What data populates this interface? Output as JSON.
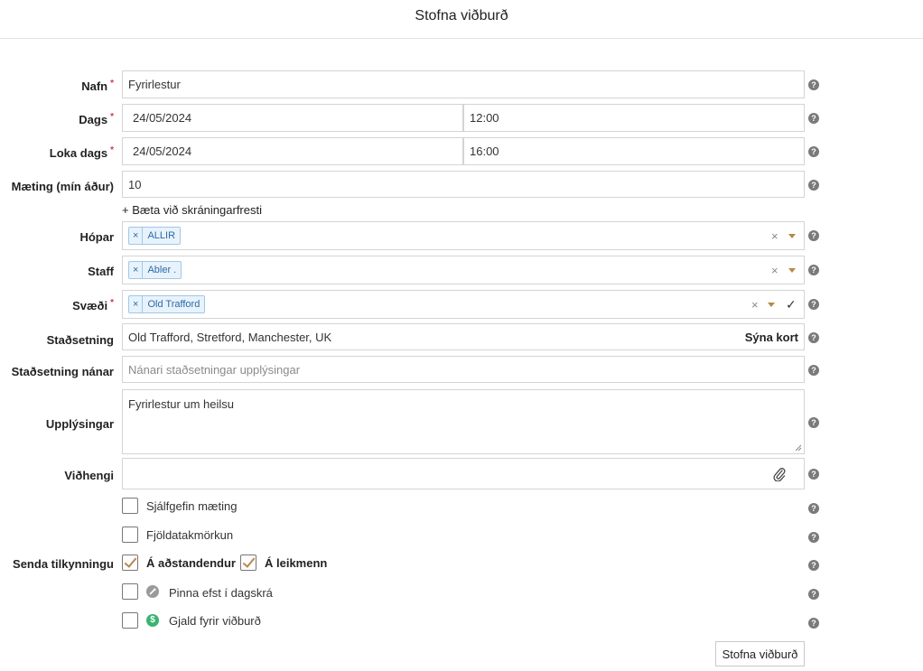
{
  "header": {
    "title": "Stofna viðburð"
  },
  "labels": {
    "name": "Nafn",
    "date": "Dags",
    "end_date": "Loka dags",
    "attendance": "Mæting (mín áður)",
    "groups": "Hópar",
    "staff": "Staff",
    "area": "Svæði",
    "location": "Staðsetning",
    "location_detail": "Staðsetning nánar",
    "info": "Upplýsingar",
    "attachment": "Viðhengi",
    "send_notification": "Senda tilkynningu"
  },
  "required_mark": "*",
  "help_glyph": "?",
  "fields": {
    "name_value": "Fyrirlestur",
    "date_value": "24/05/2024",
    "time_value": "12:00",
    "end_date_value": "24/05/2024",
    "end_time_value": "16:00",
    "attendance_value": "10",
    "location_value": "Old Trafford, Stretford, Manchester, UK",
    "show_map_label": "Sýna kort",
    "location_detail_placeholder": "Nánari staðsetningar upplýsingar",
    "info_value": "Fyrirlestur um heilsu"
  },
  "add_registration_deadline": "+ Bæta við skráningarfresti",
  "tags": {
    "groups": "ALLIR",
    "staff": "Abler .",
    "area": "Old Trafford"
  },
  "tag_remove_glyph": "×",
  "clear_glyph": "×",
  "confirm_glyph": "✓",
  "checkboxes": {
    "auto_attendance": {
      "label": "Sjálfgefin mæting",
      "checked": false
    },
    "participant_limit": {
      "label": "Fjöldatakmörkun",
      "checked": false
    },
    "notify_guardians": {
      "label": "Á aðstandendur",
      "checked": true
    },
    "notify_players": {
      "label": "Á leikmenn",
      "checked": true
    },
    "pin_top": {
      "label": "Pinna efst í dagskrá",
      "checked": false,
      "icon": "pin-icon"
    },
    "event_fee": {
      "label": "Gjald fyrir viðburð",
      "checked": false,
      "icon": "dollar-icon"
    }
  },
  "submit_label": "Stofna viðburð",
  "colors": {
    "required": "#d9363e",
    "check": "#b5884a",
    "tag_bg": "#e8f2fb",
    "tag_text": "#2a6aa8",
    "fee_icon": "#3cb371",
    "pin_icon": "#9a9a9a"
  }
}
